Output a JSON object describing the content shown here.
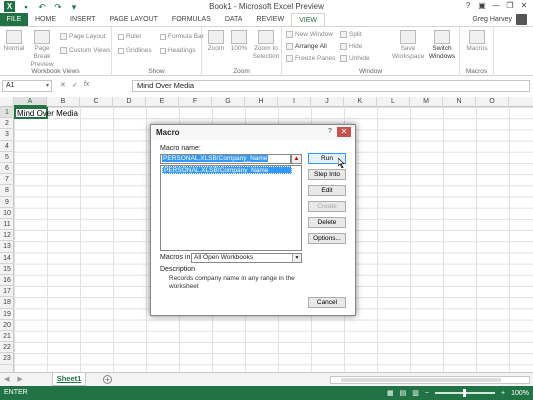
{
  "window": {
    "title": "Book1 - Microsoft Excel Preview",
    "app_icon": "X",
    "help": "?",
    "ribbon_options": "▣",
    "minimize": "—",
    "restore": "❐",
    "close": "✕"
  },
  "user": {
    "name": "Greg Harvey"
  },
  "tabs": [
    "FILE",
    "HOME",
    "INSERT",
    "PAGE LAYOUT",
    "FORMULAS",
    "DATA",
    "REVIEW",
    "VIEW"
  ],
  "ribbon": {
    "workbook_views": {
      "label": "Workbook Views",
      "normal": "Normal",
      "page_break": "Page Break Preview",
      "page_layout": "Page Layout",
      "custom_views": "Custom Views"
    },
    "show": {
      "label": "Show",
      "ruler": "Ruler",
      "formula_bar": "Formula Bar",
      "gridlines": "Gridlines",
      "headings": "Headings"
    },
    "zoom": {
      "label": "Zoom",
      "zoom": "Zoom",
      "hundred": "100%",
      "zoom_selection": "Zoom to Selection"
    },
    "window": {
      "label": "Window",
      "new_window": "New Window",
      "arrange_all": "Arrange All",
      "freeze_panes": "Freeze Panes",
      "split": "Split",
      "hide": "Hide",
      "unhide": "Unhide",
      "save_workspace": "Save Workspace",
      "switch_windows": "Switch Windows"
    },
    "macros": {
      "label": "Macros",
      "macros": "Macros"
    }
  },
  "formula_bar": {
    "name_box": "A1",
    "cancel": "✕",
    "enter": "✓",
    "fx": "fx",
    "content": "Mind Over Media"
  },
  "grid": {
    "columns": [
      "A",
      "B",
      "C",
      "D",
      "E",
      "F",
      "G",
      "H",
      "I",
      "J",
      "K",
      "L",
      "M",
      "N",
      "O"
    ],
    "rows": [
      "1",
      "2",
      "3",
      "4",
      "5",
      "6",
      "7",
      "8",
      "9",
      "10",
      "11",
      "12",
      "13",
      "14",
      "15",
      "16",
      "17",
      "18",
      "19",
      "20",
      "21",
      "22",
      "23"
    ],
    "a1_value": "Mind Over Media"
  },
  "sheets": {
    "active": "Sheet1",
    "add": "+"
  },
  "status": {
    "mode": "ENTER",
    "zoom": "100%",
    "zoom_minus": "−",
    "zoom_plus": "+"
  },
  "dialog": {
    "title": "Macro",
    "help": "?",
    "close": "✕",
    "macro_name_label": "Macro name:",
    "macro_name_value": "PERSONAL.XLSB!Company_Name",
    "list": [
      "PERSONAL.XLSB!Company_Name"
    ],
    "buttons": {
      "run": "Run",
      "step_into": "Step Into",
      "edit": "Edit",
      "create": "Create",
      "delete": "Delete",
      "options": "Options...",
      "cancel": "Cancel"
    },
    "macros_in_label": "Macros in:",
    "macros_in_value": "All Open Workbooks",
    "description_label": "Description",
    "description_text": "Records company name in any range in the worksheet"
  }
}
